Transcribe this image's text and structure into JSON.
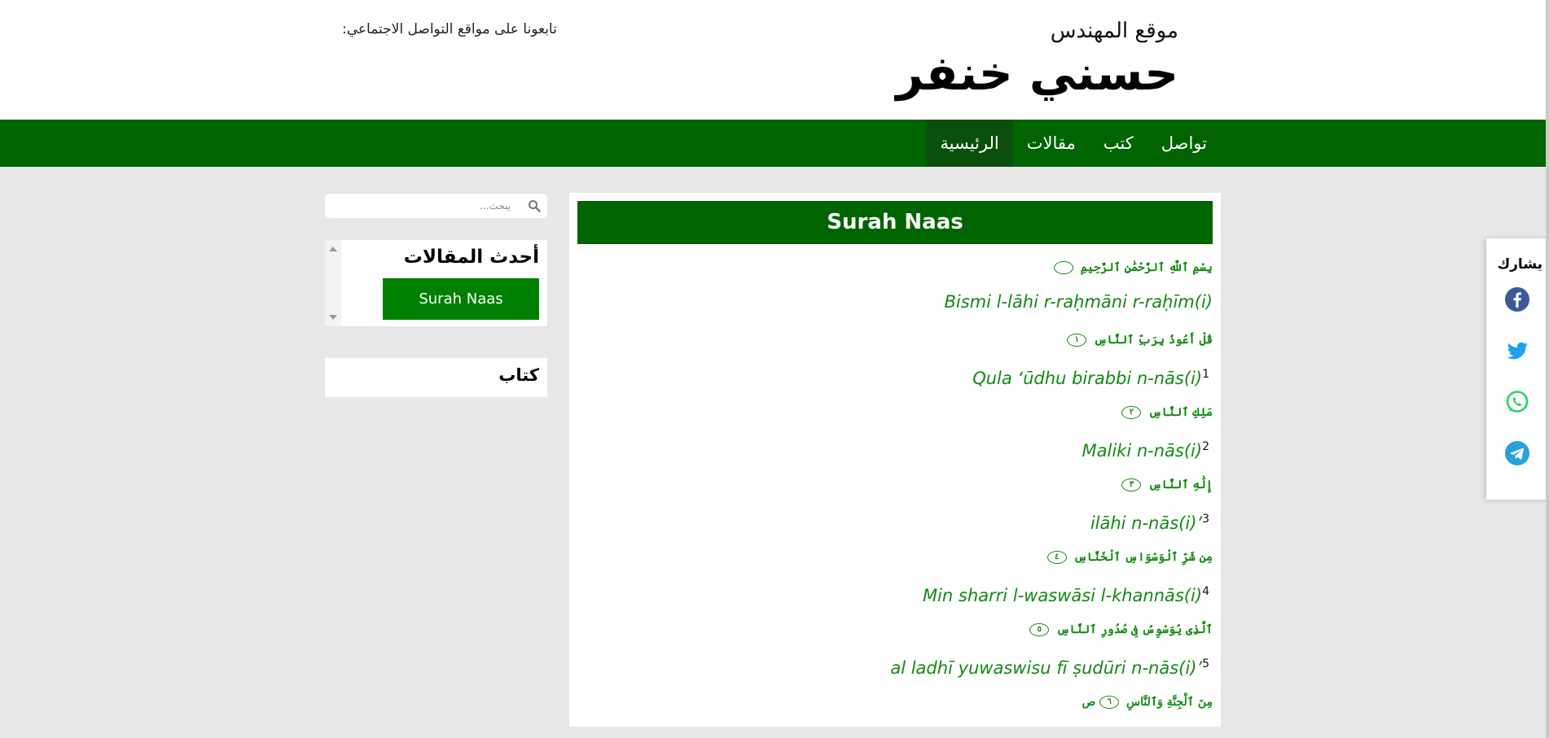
{
  "header": {
    "site_subtitle": "موقع المهندس",
    "site_name": "حسني خنفر",
    "follow_text": "تابعونا على مواقع التواصل الاجتماعي:"
  },
  "nav": {
    "items": [
      {
        "label": "الرئيسية",
        "active": true
      },
      {
        "label": "مقالات",
        "active": false
      },
      {
        "label": "كتب",
        "active": false
      },
      {
        "label": "تواصل",
        "active": false
      }
    ]
  },
  "article": {
    "title": "Surah Naas",
    "basmala_arabic": "بِسْمِ ٱللَّهِ ٱلرَّحْمَٰنِ ٱلرَّحِيمِ",
    "basmala_translit": "Bismi l-lāhi r-raḥmāni r-raḥīm(i)",
    "verses": [
      {
        "number": "1",
        "arabic": "قُلْ أَعُوذُ بِرَبِّ ٱلنَّاسِ",
        "ayah": "١",
        "translit": "Qula ‘ūdhu birabbi n-nās(i)"
      },
      {
        "number": "2",
        "arabic": "مَلِكِ ٱلنَّاسِ",
        "ayah": "٢",
        "translit": "Maliki n-nās(i)"
      },
      {
        "number": "3",
        "arabic": "إِلَٰهِ ٱلنَّاسِ",
        "ayah": "٣",
        "translit": "ilāhi n-nās(i)’"
      },
      {
        "number": "4",
        "arabic": "مِن شَرِّ ٱلْوَسْوَاسِ ٱلْخَنَّاسِ",
        "ayah": "٤",
        "translit": "Min sharri l-waswāsi l-khannās(i)"
      },
      {
        "number": "5",
        "arabic": "ٱلَّذِى يُوَسْوِسُ فِى صُدُورِ ٱلنَّاسِ",
        "ayah": "٥",
        "translit": "al ladhī yuwaswisu fī ṣudūri n-nās(i)’"
      }
    ],
    "last_arabic": "مِنَ ٱلْجِنَّةِ وَٱلنَّاسِ",
    "last_ayah": "٦",
    "last_suffix": "ص"
  },
  "sidebar": {
    "search_placeholder": "يبحث...",
    "latest_title": "أحدث المقالات",
    "latest_posts": [
      "Surah Naas"
    ],
    "book_title": "كتاب"
  },
  "share": {
    "title": "يشارك",
    "icons": [
      {
        "name": "facebook-icon",
        "color": "#3b5998"
      },
      {
        "name": "twitter-icon",
        "color": "#1da1f2"
      },
      {
        "name": "whatsapp-icon",
        "color": "#25d366"
      },
      {
        "name": "telegram-icon",
        "color": "#2aa1da"
      }
    ]
  },
  "colors": {
    "nav_green": "#006400",
    "active_nav": "#0a4f0a",
    "verse_green": "#138a13",
    "button_green": "#008000"
  }
}
